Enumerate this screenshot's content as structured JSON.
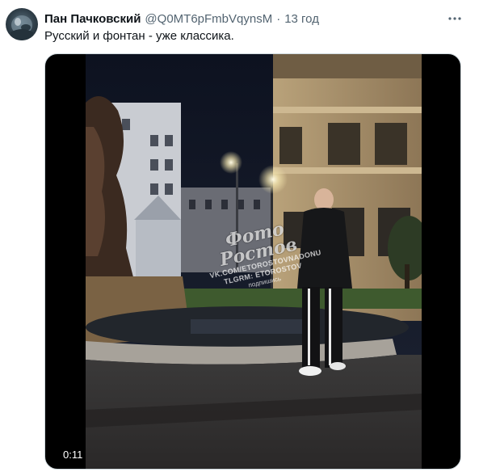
{
  "tweet": {
    "display_name": "Пан Пачковский",
    "handle": "@Q0MT6pFmbVqynsM",
    "separator": "·",
    "time": "13 год",
    "text": "Русский и фонтан - уже классика.",
    "more_icon": "more-horizontal-icon"
  },
  "media": {
    "type": "video",
    "duration": "0:11",
    "watermark": {
      "logo": "Фото Ростов",
      "line1": "VK.COM/ETOROSTOVNADONU",
      "line2": "TLGRM: ETOROSTOV",
      "line3": "подпишись"
    }
  },
  "colors": {
    "text_primary": "#0f1419",
    "text_secondary": "#536471",
    "media_border": "#cfd9de",
    "video_background": "#000000"
  }
}
